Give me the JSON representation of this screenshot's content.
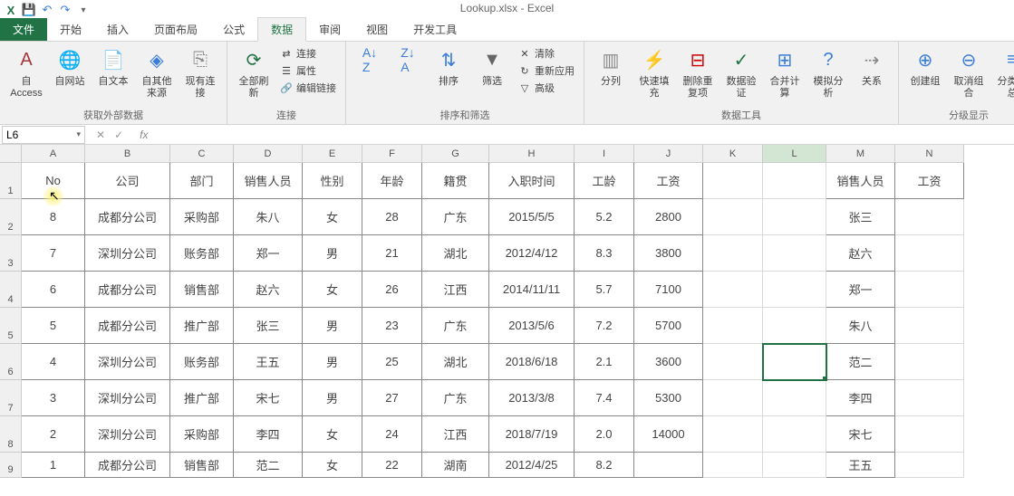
{
  "app_title": "Lookup.xlsx - Excel",
  "tabs": {
    "file": "文件",
    "home": "开始",
    "insert": "插入",
    "layout": "页面布局",
    "formula": "公式",
    "data": "数据",
    "review": "审阅",
    "view": "视图",
    "dev": "开发工具"
  },
  "ribbon": {
    "ext_data": {
      "access": "自 Access",
      "web": "自网站",
      "text": "自文本",
      "other": "自其他来源",
      "existing": "现有连接",
      "label": "获取外部数据"
    },
    "conn": {
      "refresh": "全部刷新",
      "connections": "连接",
      "properties": "属性",
      "editlinks": "编辑链接",
      "label": "连接"
    },
    "sort": {
      "sort": "排序",
      "filter": "筛选",
      "clear": "清除",
      "reapply": "重新应用",
      "advanced": "高级",
      "label": "排序和筛选"
    },
    "tools": {
      "texttocol": "分列",
      "flashfill": "快速填充",
      "removedup": "删除重复项",
      "validate": "数据验证",
      "consolidate": "合并计算",
      "whatif": "模拟分析",
      "relations": "关系",
      "label": "数据工具"
    },
    "outline": {
      "group": "创建组",
      "ungroup": "取消组合",
      "subtotal": "分类汇总",
      "label": "分级显示"
    }
  },
  "namebox": "L6",
  "columns": [
    "A",
    "B",
    "C",
    "D",
    "E",
    "F",
    "G",
    "H",
    "I",
    "J",
    "K",
    "L",
    "M",
    "N"
  ],
  "rows": [
    "1",
    "2",
    "3",
    "4",
    "5",
    "6",
    "7",
    "8",
    "9"
  ],
  "header_row": {
    "A": "No",
    "B": "公司",
    "C": "部门",
    "D": "销售人员",
    "E": "性别",
    "F": "年龄",
    "G": "籍贯",
    "H": "入职时间",
    "I": "工龄",
    "J": "工资",
    "M": "销售人员",
    "N": "工资"
  },
  "data": [
    {
      "A": "8",
      "B": "成都分公司",
      "C": "采购部",
      "D": "朱八",
      "E": "女",
      "F": "28",
      "G": "广东",
      "H": "2015/5/5",
      "I": "5.2",
      "J": "2800",
      "M": "张三"
    },
    {
      "A": "7",
      "B": "深圳分公司",
      "C": "账务部",
      "D": "郑一",
      "E": "男",
      "F": "21",
      "G": "湖北",
      "H": "2012/4/12",
      "I": "8.3",
      "J": "3800",
      "M": "赵六"
    },
    {
      "A": "6",
      "B": "成都分公司",
      "C": "销售部",
      "D": "赵六",
      "E": "女",
      "F": "26",
      "G": "江西",
      "H": "2014/11/11",
      "I": "5.7",
      "J": "7100",
      "M": "郑一"
    },
    {
      "A": "5",
      "B": "成都分公司",
      "C": "推广部",
      "D": "张三",
      "E": "男",
      "F": "23",
      "G": "广东",
      "H": "2013/5/6",
      "I": "7.2",
      "J": "5700",
      "M": "朱八"
    },
    {
      "A": "4",
      "B": "深圳分公司",
      "C": "账务部",
      "D": "王五",
      "E": "男",
      "F": "25",
      "G": "湖北",
      "H": "2018/6/18",
      "I": "2.1",
      "J": "3600",
      "M": "范二"
    },
    {
      "A": "3",
      "B": "深圳分公司",
      "C": "推广部",
      "D": "宋七",
      "E": "男",
      "F": "27",
      "G": "广东",
      "H": "2013/3/8",
      "I": "7.4",
      "J": "5300",
      "M": "李四"
    },
    {
      "A": "2",
      "B": "深圳分公司",
      "C": "采购部",
      "D": "李四",
      "E": "女",
      "F": "24",
      "G": "江西",
      "H": "2018/7/19",
      "I": "2.0",
      "J": "14000",
      "M": "宋七"
    },
    {
      "A": "1",
      "B": "成都分公司",
      "C": "销售部",
      "D": "范二",
      "E": "女",
      "F": "22",
      "G": "湖南",
      "H": "2012/4/25",
      "I": "8.2",
      "J": "",
      "M": "王五"
    }
  ]
}
